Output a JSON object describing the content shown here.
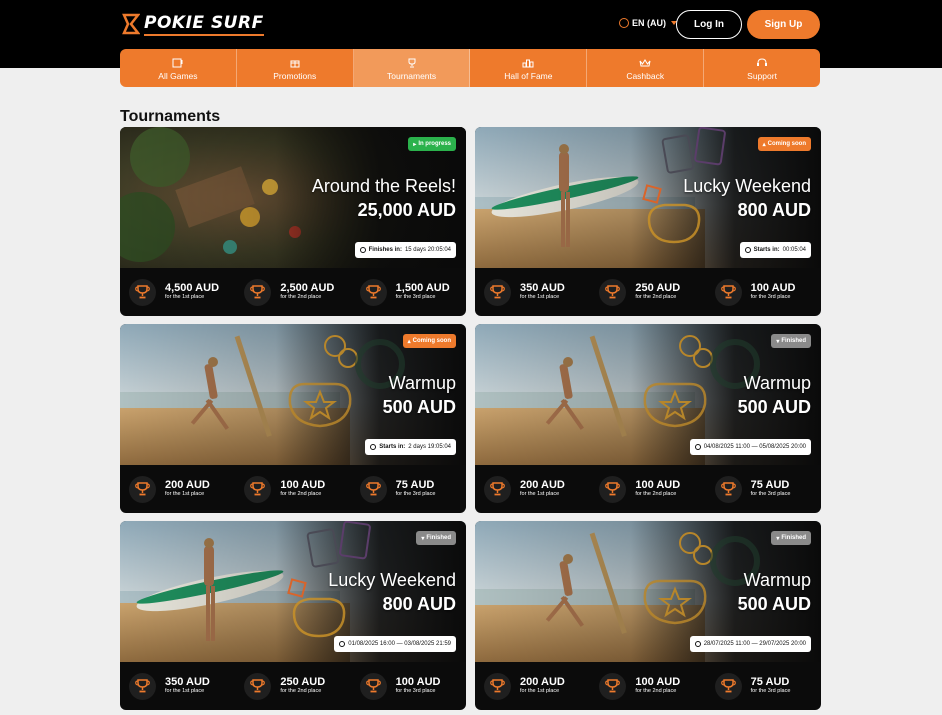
{
  "brand": {
    "name": "POKIE SURF",
    "accent": "#ee7a2c"
  },
  "header": {
    "language": "EN (AU)",
    "login_label": "Log In",
    "signup_label": "Sign Up"
  },
  "nav": [
    {
      "label": "All Games",
      "icon": "slot-machine-icon",
      "active": false
    },
    {
      "label": "Promotions",
      "icon": "gift-icon",
      "active": false
    },
    {
      "label": "Tournaments",
      "icon": "trophy-icon",
      "active": true
    },
    {
      "label": "Hall of Fame",
      "icon": "podium-icon",
      "active": false
    },
    {
      "label": "Cashback",
      "icon": "crown-icon",
      "active": false
    },
    {
      "label": "Support",
      "icon": "headset-icon",
      "active": false
    }
  ],
  "page": {
    "title": "Tournaments"
  },
  "tournaments": [
    {
      "name": "Around the Reels!",
      "prize": "25,000 AUD",
      "status": "In progress",
      "status_type": "progress",
      "timer_label": "Finishes in:",
      "timer_value": "15 days 20:05:04",
      "scene": "reels",
      "prizes": [
        {
          "amount": "4,500 AUD",
          "place": "for the 1st place"
        },
        {
          "amount": "2,500 AUD",
          "place": "for the 2nd place"
        },
        {
          "amount": "1,500 AUD",
          "place": "for the 3rd place"
        }
      ]
    },
    {
      "name": "Lucky Weekend",
      "prize": "800 AUD",
      "status": "Coming soon",
      "status_type": "soon",
      "timer_label": "Starts in:",
      "timer_value": "00:05:04",
      "scene": "surfboard",
      "prizes": [
        {
          "amount": "350 AUD",
          "place": "for the 1st place"
        },
        {
          "amount": "250 AUD",
          "place": "for the 2nd place"
        },
        {
          "amount": "100 AUD",
          "place": "for the 3rd place"
        }
      ]
    },
    {
      "name": "Warmup",
      "prize": "500 AUD",
      "status": "Coming soon",
      "status_type": "soon",
      "timer_label": "Starts in:",
      "timer_value": "2 days 19:05:04",
      "scene": "stretch",
      "prizes": [
        {
          "amount": "200 AUD",
          "place": "for the 1st place"
        },
        {
          "amount": "100 AUD",
          "place": "for the 2nd place"
        },
        {
          "amount": "75 AUD",
          "place": "for the 3rd place"
        }
      ]
    },
    {
      "name": "Warmup",
      "prize": "500 AUD",
      "status": "Finished",
      "status_type": "finished",
      "timer_label": "",
      "timer_value": "04/08/2025 11:00 — 05/08/2025 20:00",
      "scene": "stretch",
      "prizes": [
        {
          "amount": "200 AUD",
          "place": "for the 1st place"
        },
        {
          "amount": "100 AUD",
          "place": "for the 2nd place"
        },
        {
          "amount": "75 AUD",
          "place": "for the 3rd place"
        }
      ]
    },
    {
      "name": "Lucky Weekend",
      "prize": "800 AUD",
      "status": "Finished",
      "status_type": "finished",
      "timer_label": "",
      "timer_value": "01/08/2025 16:00 — 03/08/2025 21:59",
      "scene": "surfboard",
      "prizes": [
        {
          "amount": "350 AUD",
          "place": "for the 1st place"
        },
        {
          "amount": "250 AUD",
          "place": "for the 2nd place"
        },
        {
          "amount": "100 AUD",
          "place": "for the 3rd place"
        }
      ]
    },
    {
      "name": "Warmup",
      "prize": "500 AUD",
      "status": "Finished",
      "status_type": "finished",
      "timer_label": "",
      "timer_value": "28/07/2025 11:00 — 29/07/2025 20:00",
      "scene": "stretch",
      "prizes": [
        {
          "amount": "200 AUD",
          "place": "for the 1st place"
        },
        {
          "amount": "100 AUD",
          "place": "for the 2nd place"
        },
        {
          "amount": "75 AUD",
          "place": "for the 3rd place"
        }
      ]
    }
  ]
}
